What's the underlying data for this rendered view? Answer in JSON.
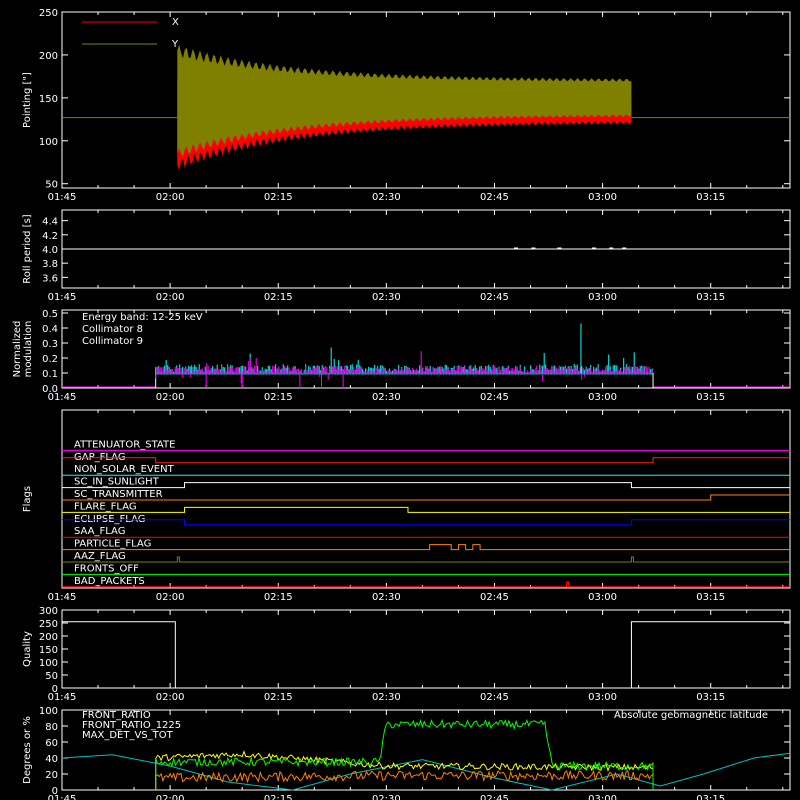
{
  "chart_data": [
    {
      "type": "line",
      "ylabel": "Pointing [\"]",
      "ylim": [
        45,
        250
      ],
      "yticks": [
        50,
        100,
        150,
        200,
        250
      ],
      "x_ticks": [
        "01:45",
        "02:00",
        "02:15",
        "02:30",
        "02:45",
        "03:00",
        "03:15"
      ],
      "legend_position": "top-left",
      "series": [
        {
          "name": "X",
          "color": "#ff0000",
          "baseline": 127,
          "band": {
            "start": "02:01",
            "end": "03:04",
            "lower_start": 72,
            "lower_end": 122,
            "upper_start": 172,
            "upper_end": 145
          }
        },
        {
          "name": "Y",
          "color": "#808000",
          "baseline": 127,
          "band": {
            "start": "02:01",
            "end": "03:04",
            "lower_start": 85,
            "lower_end": 130,
            "upper_start": 205,
            "upper_end": 170
          }
        }
      ]
    },
    {
      "type": "line",
      "ylabel": "Roll period [s]",
      "ylim": [
        3.45,
        4.55
      ],
      "yticks": [
        3.6,
        3.8,
        4.0,
        4.2,
        4.4
      ],
      "ytick_labels": [
        "3.6",
        "3.8",
        "4.0",
        "4.2",
        "4.4"
      ],
      "x_ticks": [
        "01:45",
        "02:00",
        "02:15",
        "02:30",
        "02:45",
        "03:00",
        "03:15"
      ],
      "series": [
        {
          "name": "",
          "color": "#ffffff",
          "value": 4.0,
          "start": "01:45",
          "end": "03:26"
        }
      ]
    },
    {
      "type": "line",
      "ylabel_lines": [
        "Normalized",
        "modulation"
      ],
      "ylim": [
        0,
        0.52
      ],
      "yticks": [
        0.0,
        0.1,
        0.2,
        0.3,
        0.4,
        0.5
      ],
      "ytick_labels": [
        "0.0",
        "0.1",
        "0.2",
        "0.3",
        "0.4",
        "0.5"
      ],
      "x_ticks": [
        "01:45",
        "02:00",
        "02:15",
        "02:30",
        "02:45",
        "03:00",
        "03:15"
      ],
      "annotation": "Energy band: 12-25 keV",
      "active_start": "01:58",
      "active_end": "03:07",
      "series": [
        {
          "name": "Collimator 8",
          "color": "#00ffff",
          "base": 0.1,
          "spike_max": 0.43
        },
        {
          "name": "Collimator 9",
          "color": "#ff00ff",
          "base": 0.1,
          "spike_max": 0.25
        }
      ]
    },
    {
      "type": "line",
      "ylabel": "Flags",
      "x_ticks": [
        "01:45",
        "02:00",
        "02:15",
        "02:30",
        "02:45",
        "03:00",
        "03:15"
      ],
      "flags": [
        {
          "name": "ATTENUATOR_STATE",
          "color": "#ff00ff",
          "segments": []
        },
        {
          "name": "GAP_FLAG",
          "color": "#ff2020",
          "segments": [
            [
              "01:58",
              "03:07"
            ]
          ],
          "invert": true
        },
        {
          "name": "NON_SOLAR_EVENT",
          "color": "#00ffff",
          "segments": []
        },
        {
          "name": "SC_IN_SUNLIGHT",
          "color": "#ffffff",
          "segments": [
            [
              "02:02",
              "03:04"
            ]
          ]
        },
        {
          "name": "SC_TRANSMITTER",
          "color": "#ff8000",
          "segments": [
            [
              "03:15",
              "03:26"
            ]
          ]
        },
        {
          "name": "FLARE_FLAG",
          "color": "#ffff00",
          "segments": [
            [
              "02:02",
              "02:33"
            ]
          ]
        },
        {
          "name": "ECLIPSE_FLAG",
          "color": "#0000ff",
          "segments": [
            [
              "01:45",
              "02:02"
            ],
            [
              "03:04",
              "03:26"
            ]
          ]
        },
        {
          "name": "SAA_FLAG",
          "color": "#ff0000",
          "segments": []
        },
        {
          "name": "PARTICLE_FLAG",
          "color": "#ff8000",
          "segments": [
            [
              "02:36",
              "02:39"
            ],
            [
              "02:40",
              "02:41"
            ],
            [
              "02:42",
              "02:43"
            ]
          ]
        },
        {
          "name": "AAZ_FLAG",
          "color": "#808000",
          "segments": [
            [
              "02:01",
              "02:01"
            ],
            [
              "03:04",
              "03:04"
            ]
          ]
        },
        {
          "name": "FRONTS_OFF",
          "color": "#00ff00",
          "segments": []
        },
        {
          "name": "BAD_PACKETS",
          "color": "#ff0000",
          "segments": [
            [
              "02:55",
              "02:55"
            ]
          ]
        }
      ]
    },
    {
      "type": "line",
      "ylabel": "Quality",
      "ylim": [
        0,
        300
      ],
      "yticks": [
        0,
        50,
        100,
        150,
        200,
        250,
        300
      ],
      "x_ticks": [
        "01:45",
        "02:00",
        "02:15",
        "02:30",
        "02:45",
        "03:00",
        "03:15"
      ],
      "series": [
        {
          "name": "",
          "color": "#ffffff",
          "high": 255,
          "low": 0,
          "low_start": "02:01",
          "low_end": "03:04"
        }
      ]
    },
    {
      "type": "line",
      "ylabel": "Degrees or %",
      "ylim": [
        0,
        100
      ],
      "yticks": [
        0,
        20,
        40,
        60,
        80,
        100
      ],
      "x_ticks": [
        "01:45",
        "02:00",
        "02:15",
        "02:30",
        "02:45",
        "03:00",
        "03:15"
      ],
      "annotation_right": "Absolute geomagnetic latitude",
      "series": [
        {
          "name": "FRONT_RATIO",
          "color": "#ffff00",
          "start": "01:58",
          "end": "03:07",
          "levels": [
            [
              "01:58",
              40
            ],
            [
              "02:10",
              45
            ],
            [
              "02:30",
              30
            ],
            [
              "03:07",
              28
            ]
          ]
        },
        {
          "name": "FRONT_RATIO_1225",
          "color": "#00ff00",
          "start": "01:58",
          "end": "03:07",
          "levels": [
            [
              "01:58",
              35
            ],
            [
              "02:29",
              35
            ],
            [
              "02:30",
              82
            ],
            [
              "02:52",
              82
            ],
            [
              "02:53",
              30
            ],
            [
              "03:07",
              30
            ]
          ]
        },
        {
          "name": "MAX_DET_VS_TOT",
          "color": "#ff8000",
          "start": "01:58",
          "end": "03:07",
          "levels": [
            [
              "01:58",
              15
            ],
            [
              "02:30",
              18
            ],
            [
              "03:07",
              18
            ]
          ]
        },
        {
          "name": "Absolute geomagnetic latitude",
          "color": "#00c0c0",
          "points": [
            [
              "01:45",
              40
            ],
            [
              "01:52",
              44
            ],
            [
              "02:00",
              30
            ],
            [
              "02:08",
              10
            ],
            [
              "02:17",
              0
            ],
            [
              "02:25",
              20
            ],
            [
              "02:35",
              38
            ],
            [
              "02:45",
              15
            ],
            [
              "02:53",
              0
            ],
            [
              "03:02",
              20
            ],
            [
              "03:08",
              5
            ],
            [
              "03:14",
              20
            ],
            [
              "03:21",
              40
            ],
            [
              "03:26",
              46
            ]
          ]
        }
      ]
    }
  ]
}
